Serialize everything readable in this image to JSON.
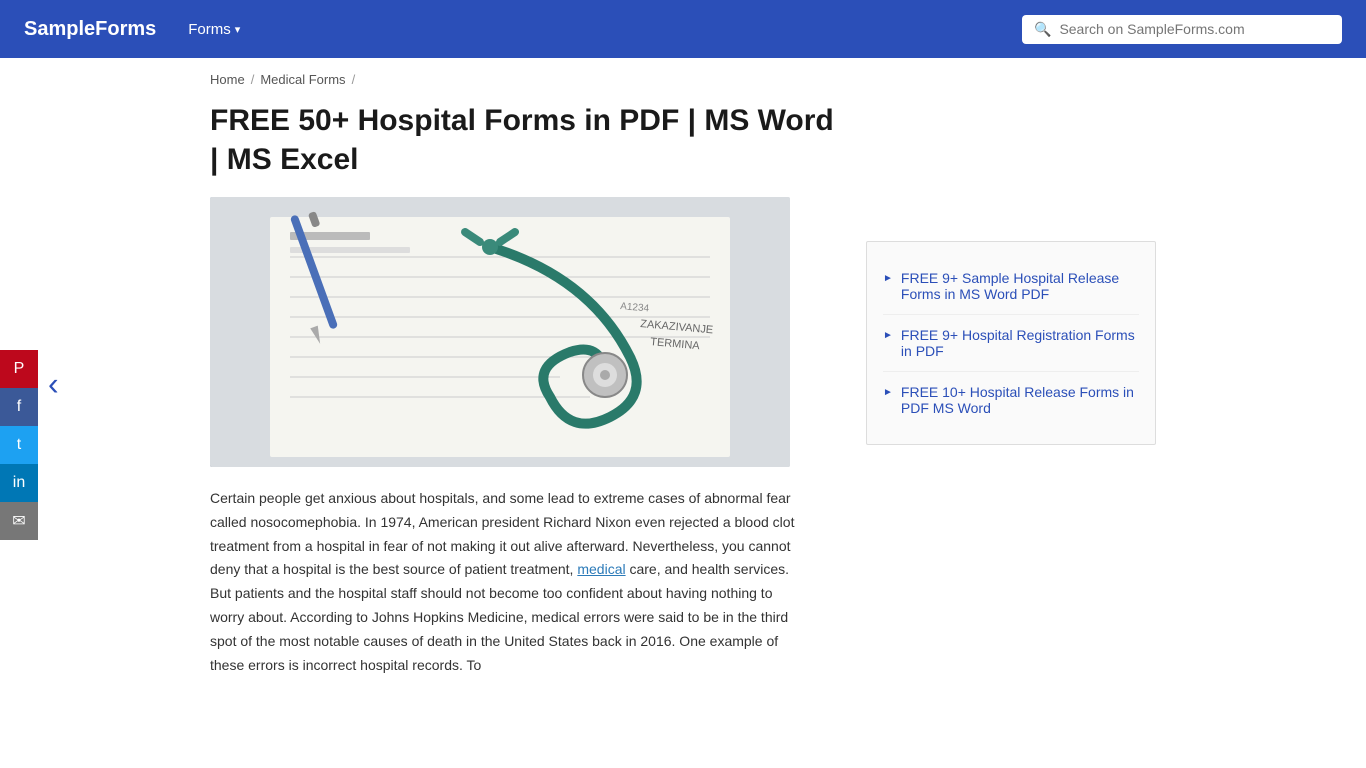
{
  "header": {
    "logo": "SampleForms",
    "nav": {
      "forms_label": "Forms",
      "chevron": "▾"
    },
    "search": {
      "placeholder": "Search on SampleForms.com"
    }
  },
  "breadcrumb": {
    "home": "Home",
    "separator1": "/",
    "medical_forms": "Medical Forms",
    "separator2": "/"
  },
  "page": {
    "title": "FREE 50+ Hospital Forms in PDF | MS Word | MS Excel"
  },
  "article": {
    "body": "Certain people get anxious about hospitals, and some lead to extreme cases of abnormal fear called nosocomephobia. In 1974, American president Richard Nixon even rejected a blood clot treatment from a hospital in fear of not making it out alive afterward. Nevertheless, you cannot deny that a hospital is the best source of patient treatment, medical care, and health services. But patients and the hospital staff should not become too confident about having nothing to worry about. According to Johns Hopkins Medicine, medical errors were said to be in the third spot of the most notable causes of death in the United States back in 2016. One example of these errors is incorrect hospital records. To",
    "medical_link": "medical"
  },
  "social": {
    "pinterest": "P",
    "facebook": "f",
    "twitter": "t",
    "linkedin": "in",
    "email": "✉"
  },
  "sidebar": {
    "links": [
      {
        "text": "FREE 9+ Sample Hospital Release Forms in MS Word PDF"
      },
      {
        "text": "FREE 9+ Hospital Registration Forms in PDF"
      },
      {
        "text": "FREE 10+ Hospital Release Forms in PDF MS Word"
      }
    ]
  }
}
